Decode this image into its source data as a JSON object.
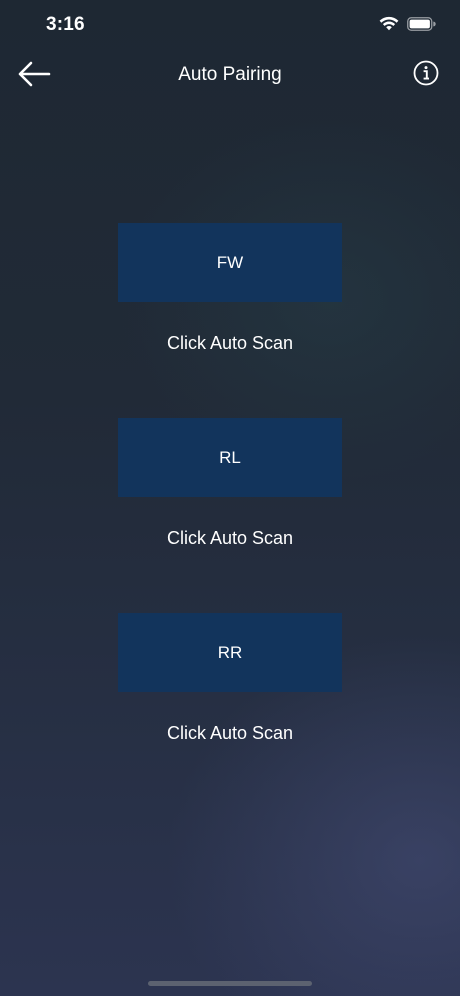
{
  "status_bar": {
    "time": "3:16",
    "icons": [
      "wifi-icon",
      "battery-icon"
    ]
  },
  "nav": {
    "title": "Auto Pairing",
    "back_icon": "arrow-left-icon",
    "info_icon": "info-circle-icon"
  },
  "sensors": [
    {
      "label": "FW",
      "status": "Click Auto Scan"
    },
    {
      "label": "RL",
      "status": "Click Auto Scan"
    },
    {
      "label": "RR",
      "status": "Click Auto Scan"
    }
  ],
  "colors": {
    "button_bg": "#12345c",
    "text": "#ffffff",
    "background_top": "#1e2833",
    "background_bottom": "#2c3450"
  }
}
